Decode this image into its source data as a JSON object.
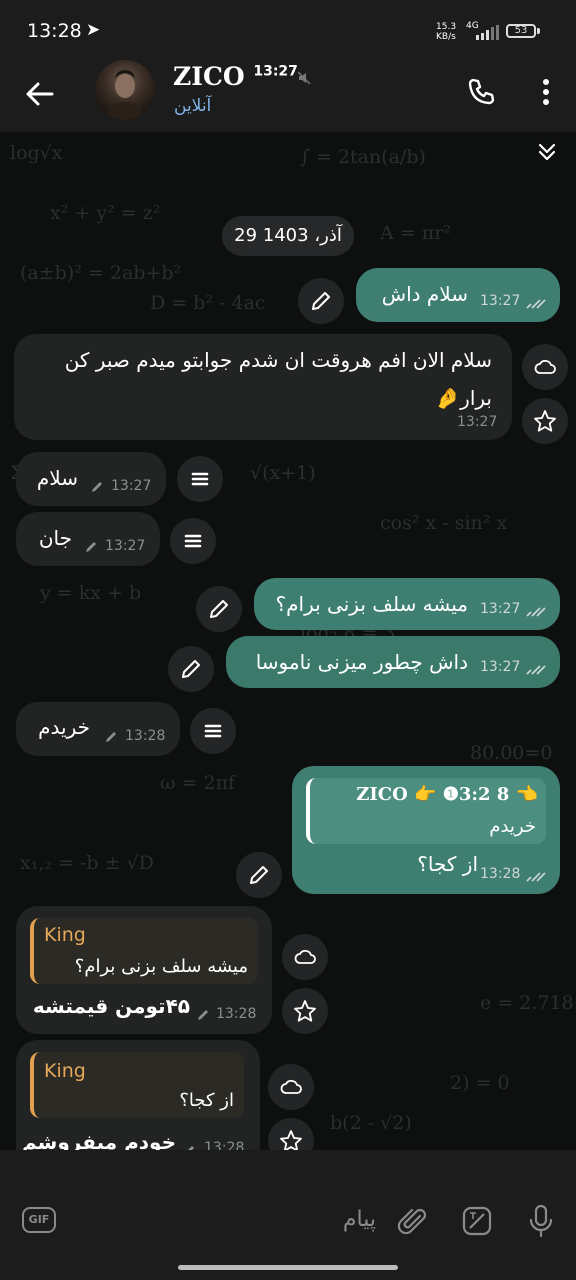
{
  "status_bar": {
    "time": "13:28",
    "speed_value": "15.3",
    "speed_unit": "KB/s",
    "network": "4G",
    "battery": "53"
  },
  "header": {
    "contact_name": "ZICO",
    "name_suffix": "13:27",
    "status": "آنلاین"
  },
  "date_pill": "29 آذر، 1403",
  "messages": [
    {
      "text": "سلام داش",
      "time": "13:27"
    },
    {
      "text_line1": "سلام الان افم هروقت ان شدم جوابتو میدم صبر کن",
      "text_line2": "برار",
      "emoji": "🤌",
      "time": "13:27"
    },
    {
      "text": "سلام",
      "time": "13:27"
    },
    {
      "text": "جان",
      "time": "13:27"
    },
    {
      "text": "میشه سلف بزنی برام؟",
      "time": "13:27"
    },
    {
      "text": "داش چطور میزنی ناموسا",
      "time": "13:27"
    },
    {
      "text": "خریدم",
      "time": "13:28"
    },
    {
      "reply_name": "ZICO 👉 ❶3:2 8 👈",
      "reply_text": "خریدم",
      "text": "از کجا؟",
      "time": "13:28"
    },
    {
      "reply_name": "King",
      "reply_text": "میشه سلف بزنی برام؟",
      "text": "۴۵تومن قیمتشه",
      "time": "13:28"
    },
    {
      "reply_name": "King",
      "reply_text": "از کجا؟",
      "text": "خودم میفروشم",
      "time": "13:28"
    }
  ],
  "input": {
    "placeholder": "پیام",
    "gif_label": "GIF"
  },
  "icons": {
    "back": "arrow-left-icon",
    "call": "phone-icon",
    "menu": "more-vertical-icon",
    "edit": "pencil-icon",
    "cloud": "cloud-icon",
    "star": "star-icon",
    "list": "list-icon",
    "attach": "paperclip-icon",
    "sticker": "sticker-icon",
    "mic": "microphone-icon"
  },
  "colors": {
    "outgoing_bubble": "#3e7f72",
    "incoming_bubble": "#222424",
    "reply_accent": "#e8a85a",
    "online": "#7fb3e6"
  }
}
